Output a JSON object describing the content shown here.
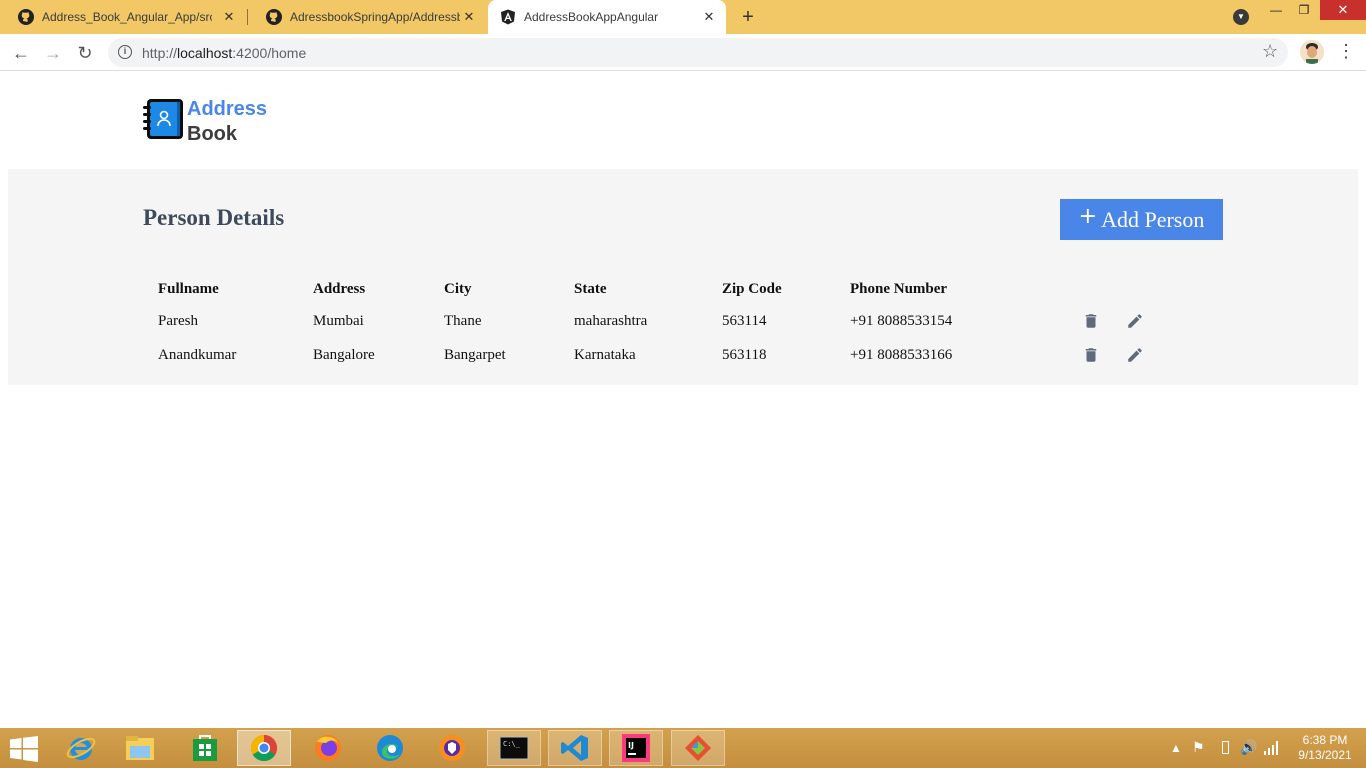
{
  "browser": {
    "tabs": [
      {
        "title": "Address_Book_Angular_App/src/a",
        "icon": "github-icon",
        "active": false
      },
      {
        "title": "AdressbookSpringApp/Addressb",
        "icon": "github-icon",
        "active": false
      },
      {
        "title": "AddressBookAppAngular",
        "icon": "angular-icon",
        "active": true
      }
    ],
    "new_tab_label": "+",
    "close_label": "✕",
    "url_scheme": "http://",
    "url_host": "localhost",
    "url_path": ":4200/home"
  },
  "app": {
    "brand_line1": "Address",
    "brand_line2": "Book",
    "section_title": "Person Details",
    "add_button_plus": "+",
    "add_button_label": "Add Person",
    "columns": [
      "Fullname",
      "Address",
      "City",
      "State",
      "Zip Code",
      "Phone Number"
    ],
    "people": [
      {
        "fullname": "Paresh",
        "address": "Mumbai",
        "city": "Thane",
        "state": "maharashtra",
        "zip": "563114",
        "phone": "+91 8088533154"
      },
      {
        "fullname": "Anandkumar",
        "address": "Bangalore",
        "city": "Bangarpet",
        "state": "Karnataka",
        "zip": "563118",
        "phone": "+91 8088533166"
      }
    ],
    "colors": {
      "accent": "#4a86e8",
      "panel": "#f5f5f5",
      "title": "#3d4a5c"
    }
  },
  "taskbar": {
    "time": "6:38 PM",
    "date": "9/13/2021",
    "apps": [
      "internet-explorer-icon",
      "file-explorer-icon",
      "store-icon",
      "chrome-icon",
      "firefox-icon",
      "edge-icon",
      "brave-icon",
      "terminal-icon",
      "vscode-icon",
      "intellij-icon",
      "git-icon"
    ]
  }
}
